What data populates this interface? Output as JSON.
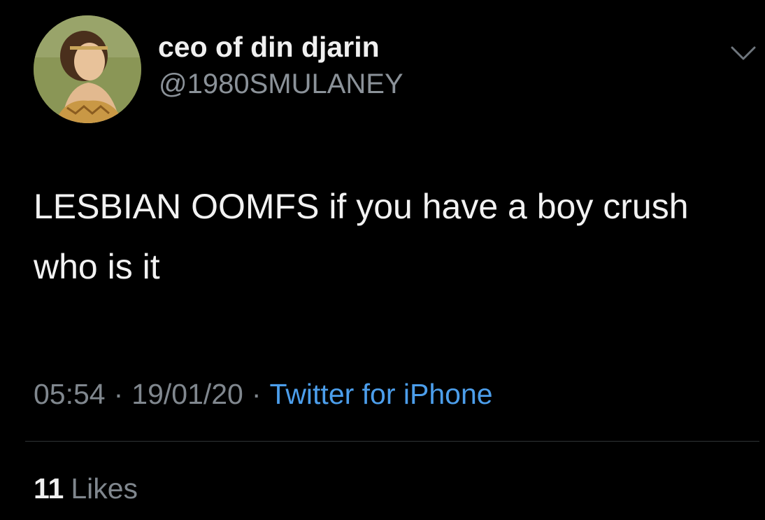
{
  "user": {
    "display_name": "ceo of din djarin",
    "handle": "@1980SMULANEY",
    "avatar_icon": "profile-photo"
  },
  "tweet": {
    "text": "LESBIAN OOMFS if you have a boy crush who is it",
    "time": "05:54",
    "date": "19/01/20",
    "separator": "·",
    "source": "Twitter for iPhone"
  },
  "stats": {
    "likes_count": "11",
    "likes_label": "Likes"
  },
  "colors": {
    "background": "#000000",
    "link": "#4c9eeb",
    "secondary_text": "#80878e"
  },
  "icons": {
    "menu": "chevron-down-icon"
  }
}
